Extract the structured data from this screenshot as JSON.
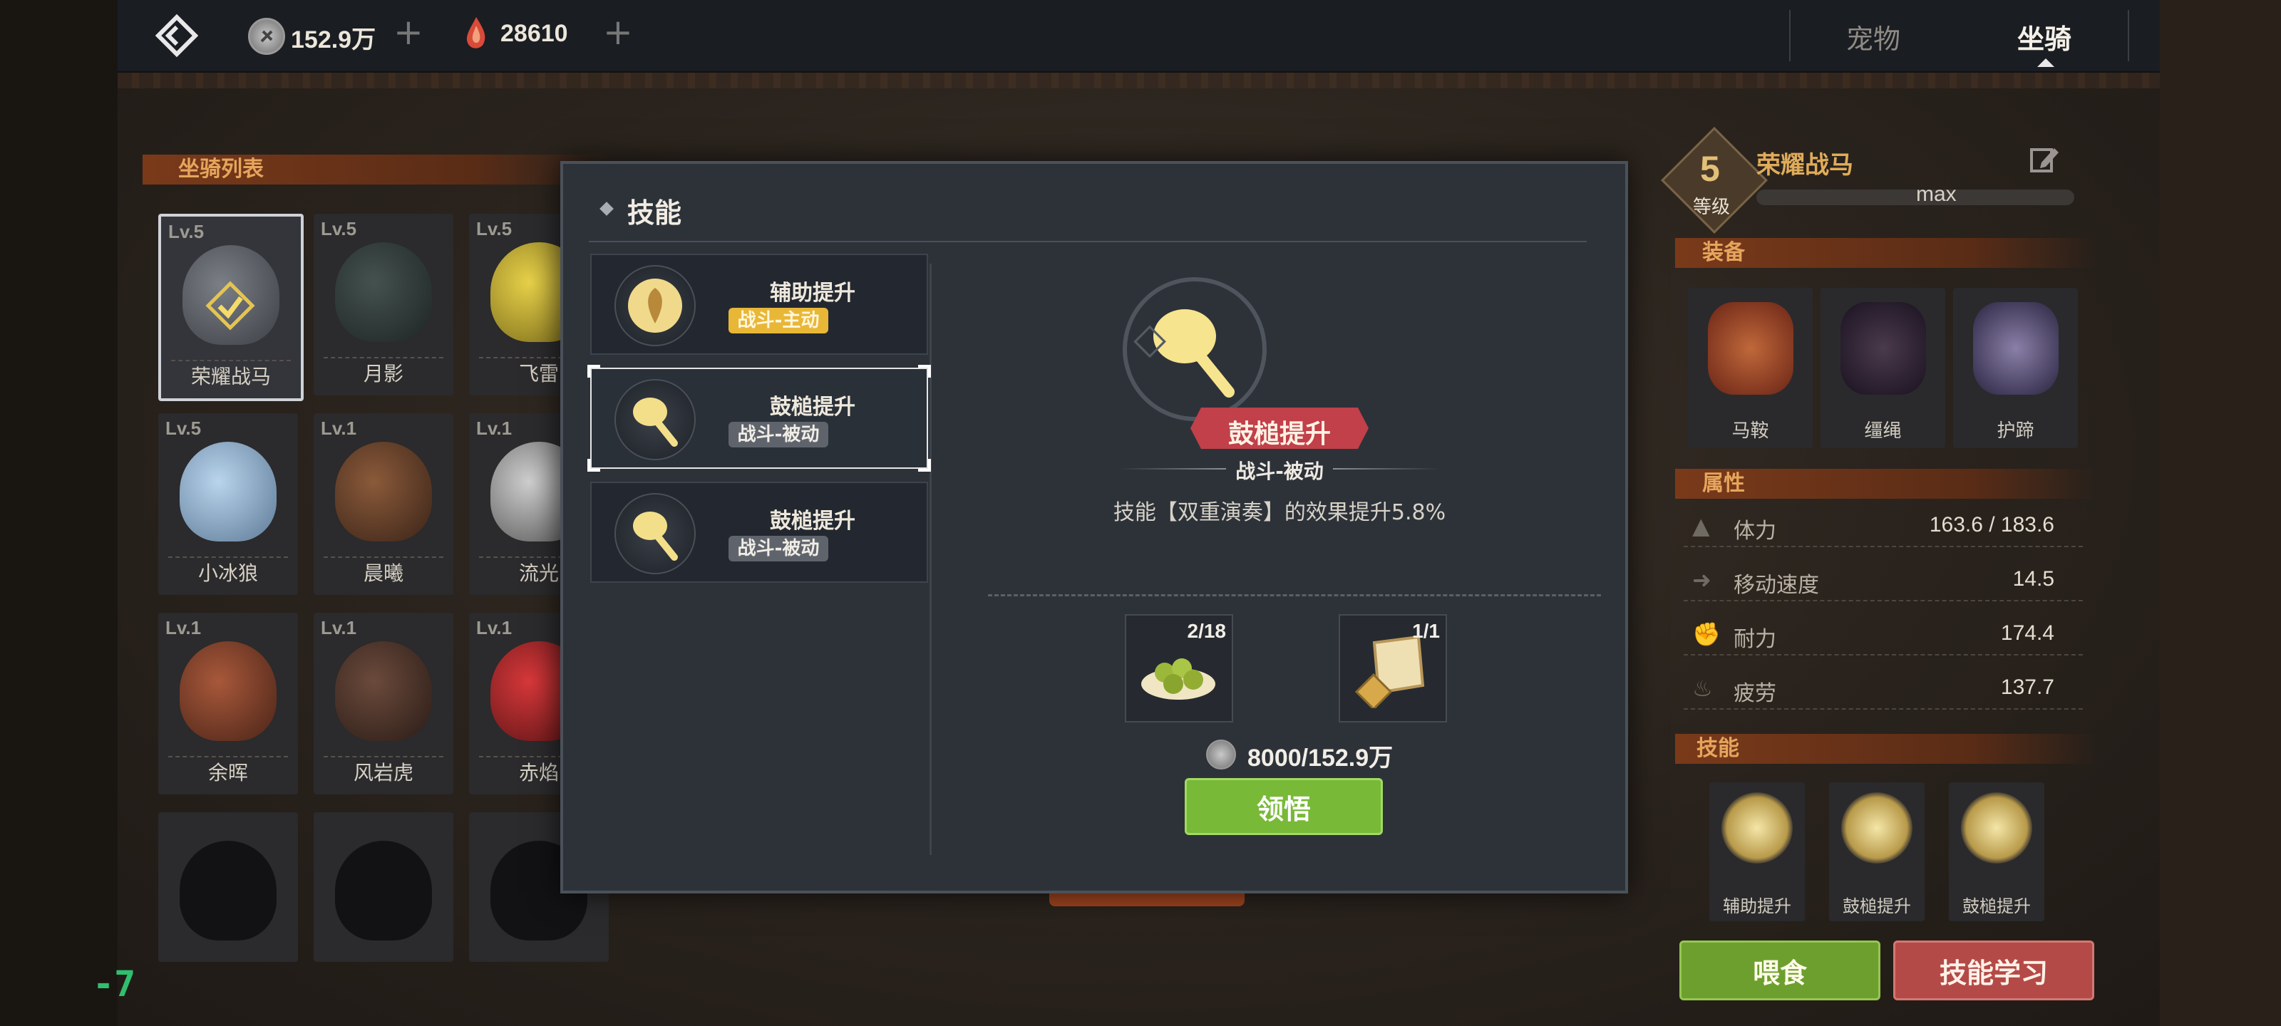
{
  "top": {
    "coins": "152.9万",
    "gems": "28610",
    "tabs": [
      {
        "label": "宠物",
        "active": false
      },
      {
        "label": "坐骑",
        "active": true
      }
    ]
  },
  "mount_list": {
    "title": "坐骑列表",
    "items": [
      {
        "level": "Lv.5",
        "name": "荣耀战马",
        "selected": true
      },
      {
        "level": "Lv.5",
        "name": "月影"
      },
      {
        "level": "Lv.5",
        "name": "飞雷"
      },
      {
        "level": "Lv.5",
        "name": "小冰狼"
      },
      {
        "level": "Lv.1",
        "name": "晨曦"
      },
      {
        "level": "Lv.1",
        "name": "流光"
      },
      {
        "level": "Lv.1",
        "name": "余晖"
      },
      {
        "level": "Lv.1",
        "name": "风岩虎"
      },
      {
        "level": "Lv.1",
        "name": "赤焰"
      }
    ]
  },
  "detail": {
    "level": "5",
    "level_label": "等级",
    "name": "荣耀战马",
    "exp_text": "max",
    "equip_title": "装备",
    "equipment": [
      "马鞍",
      "缰绳",
      "护蹄"
    ],
    "attr_title": "属性",
    "stats": [
      {
        "key": "体力",
        "value": "163.6 / 183.6"
      },
      {
        "key": "移动速度",
        "value": "14.5"
      },
      {
        "key": "耐力",
        "value": "174.4"
      },
      {
        "key": "疲劳",
        "value": "137.7"
      }
    ],
    "skill_title": "技能",
    "skills": [
      "辅助提升",
      "鼓槌提升",
      "鼓槌提升"
    ],
    "feed_button": "喂食",
    "learn_button": "技能学习"
  },
  "modal": {
    "title": "技能",
    "skills": [
      {
        "name": "辅助提升",
        "tag": "战斗-主动"
      },
      {
        "name": "鼓槌提升",
        "tag": "战斗-被动"
      },
      {
        "name": "鼓槌提升",
        "tag": "战斗-被动"
      }
    ],
    "selected": {
      "name": "鼓槌提升",
      "type": "战斗-被动",
      "desc": "技能【双重演奏】的效果提升5.8%"
    },
    "materials": [
      {
        "count": "2/18"
      },
      {
        "count": "1/1"
      }
    ],
    "cost": "8000/152.9万",
    "confirm_button": "领悟"
  },
  "debug_counter": "-7",
  "colors": {
    "gold": "#f1d36a",
    "green_button": "#79b93a",
    "red_button": "#b74a4a",
    "section": "#e6a55c"
  }
}
